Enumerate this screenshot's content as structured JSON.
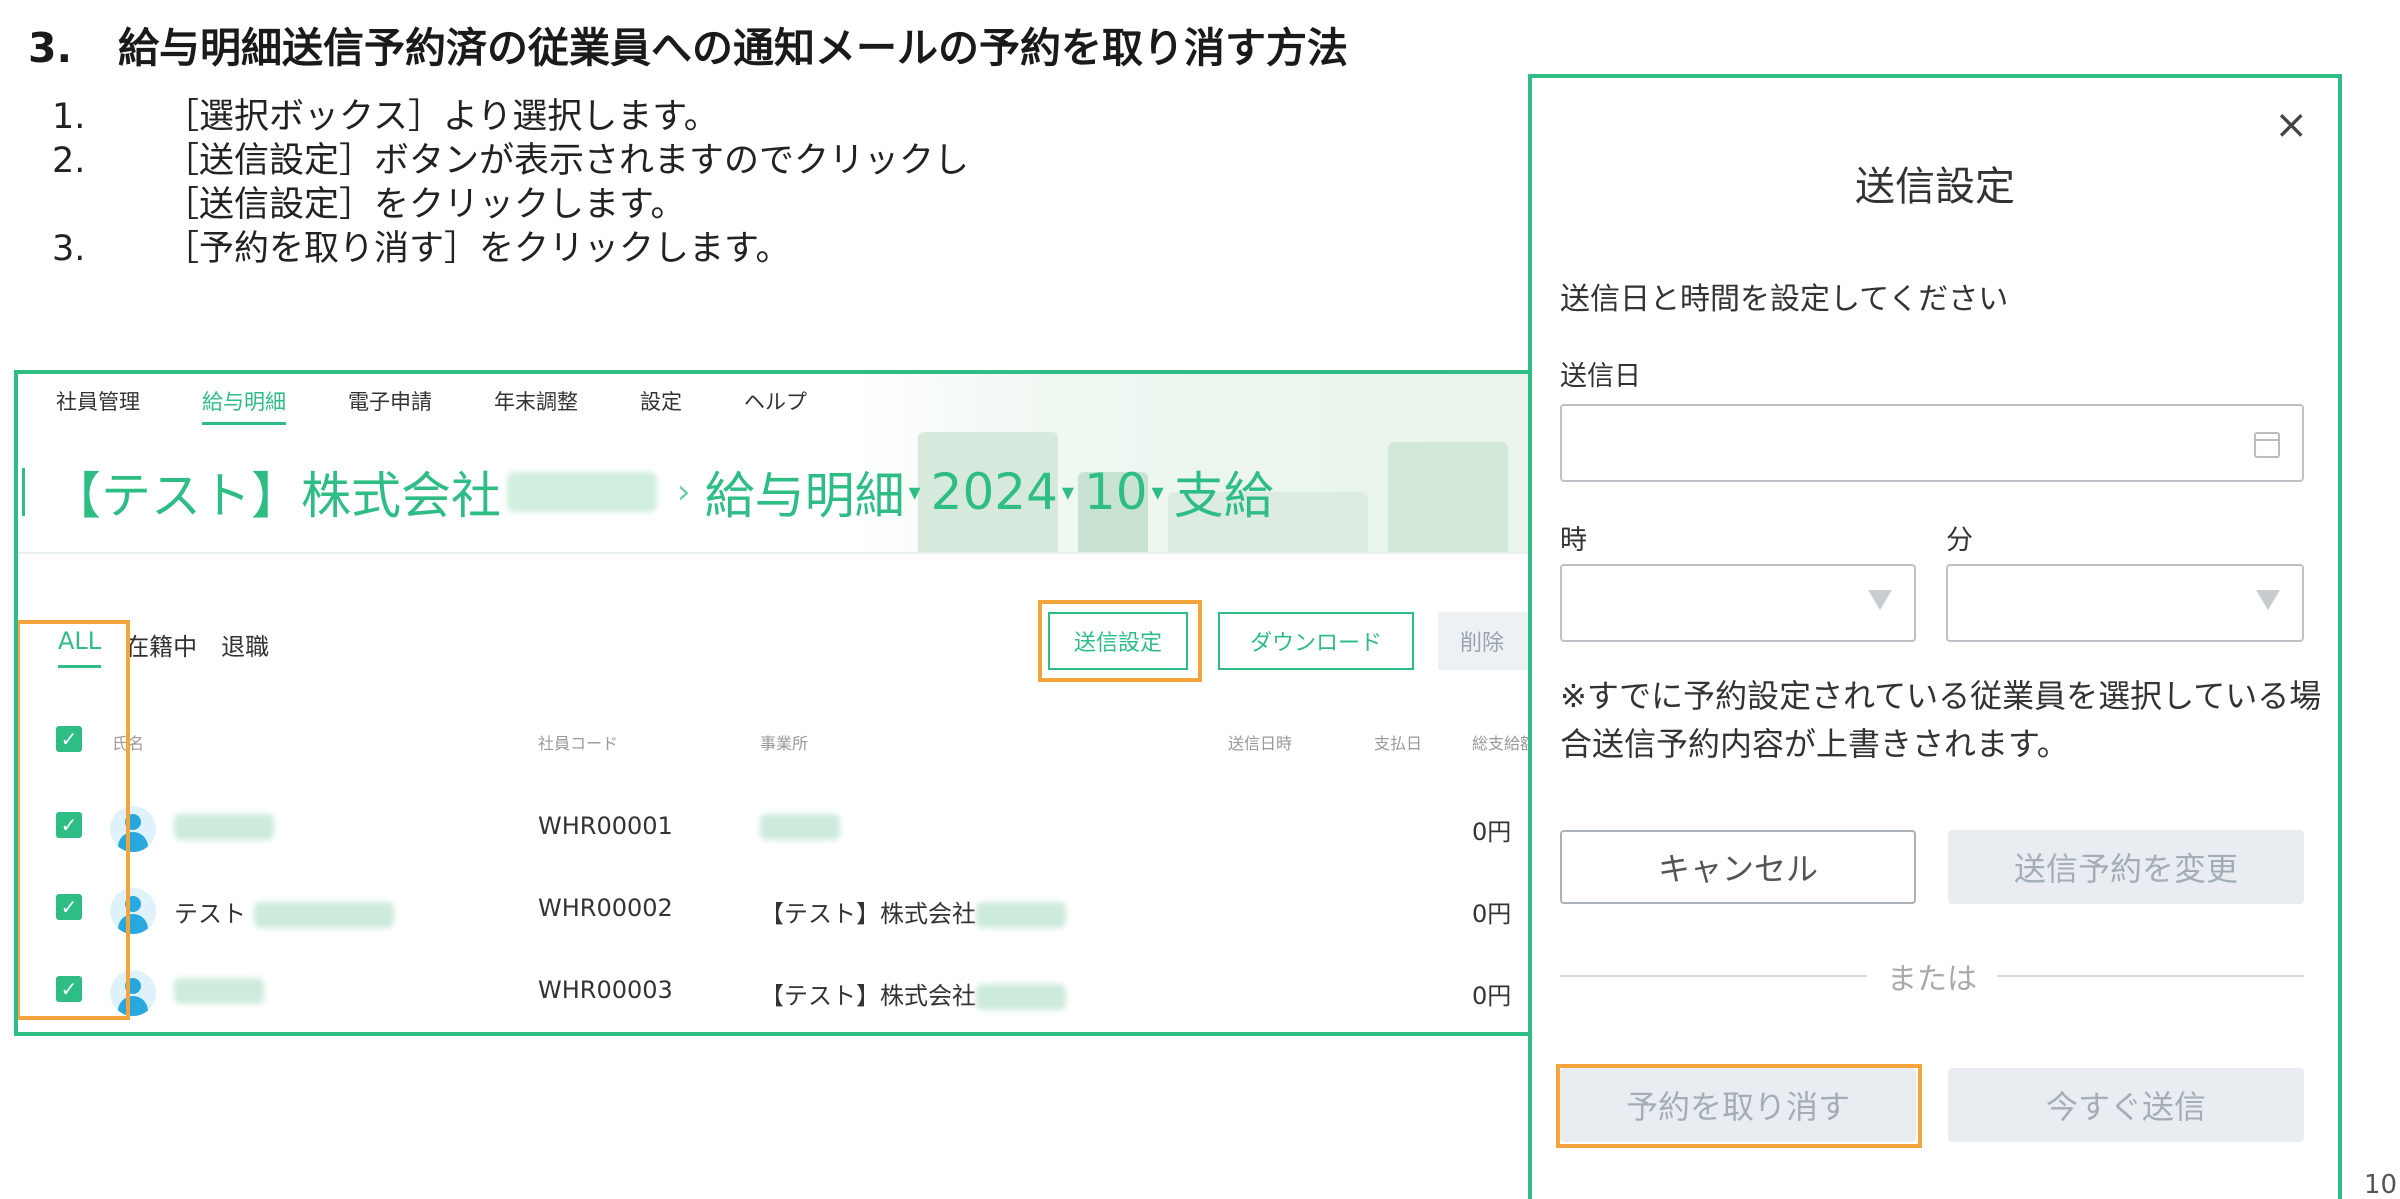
{
  "heading": {
    "number": "3.",
    "text": "給与明細送信予約済の従業員への通知メールの予約を取り消す方法"
  },
  "steps": [
    {
      "n": "1.",
      "lines": [
        "［選択ボックス］より選択します。"
      ]
    },
    {
      "n": "2.",
      "lines": [
        "［送信設定］ボタンが表示されますのでクリックし",
        "［送信設定］をクリックします。"
      ]
    },
    {
      "n": "3.",
      "lines": [
        "［予約を取り消す］をクリックします。"
      ]
    }
  ],
  "app": {
    "menu": [
      "社員管理",
      "給与明細",
      "電子申請",
      "年末調整",
      "設定",
      "ヘルプ"
    ],
    "breadcrumb": {
      "company": "【テスト】株式会社",
      "separator": "›",
      "section": "給与明細",
      "year": "2024",
      "month": "10",
      "kind": "支給",
      "caret": "▾"
    },
    "filters": [
      "ALL",
      "在籍中",
      "退職"
    ],
    "buttons": {
      "send": "送信設定",
      "download": "ダウンロード",
      "delete": "削除"
    },
    "columns": [
      "氏名",
      "社員コード",
      "事業所",
      "送信日時",
      "支払日",
      "総支給額"
    ],
    "check": "✓",
    "rows": [
      {
        "name": "",
        "code": "WHR00001",
        "office": "",
        "amount": "0円"
      },
      {
        "name": "テスト",
        "code": "WHR00002",
        "office": "【テスト】株式会社",
        "amount": "0円"
      },
      {
        "name": "",
        "code": "WHR00003",
        "office": "【テスト】株式会社",
        "amount": "0円"
      }
    ]
  },
  "dialog": {
    "close": "×",
    "title": "送信設定",
    "description": "送信日と時間を設定してください",
    "date_label": "送信日",
    "hour_label": "時",
    "minute_label": "分",
    "note": "※すでに予約設定されている従業員を選択している場合送信予約内容が上書きされます。",
    "cancel": "キャンセル",
    "change": "送信予約を変更",
    "or": "または",
    "cancel_reservation": "予約を取り消す",
    "send_now": "今すぐ送信"
  },
  "page_number": "10",
  "colors": {
    "accent": "#2ebd85",
    "highlight": "#f5a33b",
    "avatar": "#29a8e0"
  }
}
